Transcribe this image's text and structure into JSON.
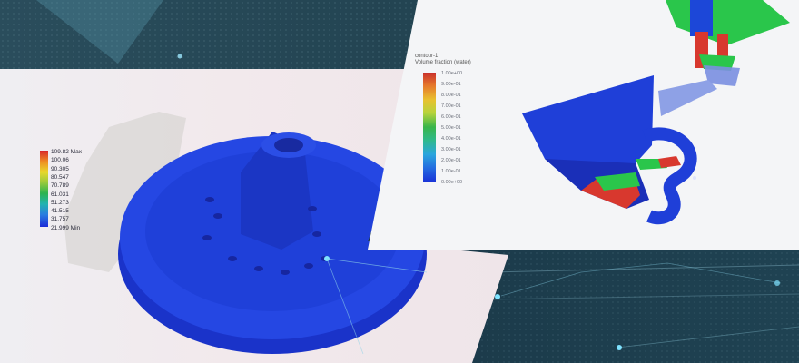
{
  "left_legend": {
    "labels": [
      "109.82 Max",
      "100.06",
      "90.305",
      "80.547",
      "70.789",
      "61.031",
      "51.273",
      "41.515",
      "31.757",
      "21.999 Min"
    ]
  },
  "right_legend": {
    "title_line1": "contour-1",
    "title_line2": "Volume fraction (water)",
    "labels": [
      "1.00e+00",
      "9.00e-01",
      "8.00e-01",
      "7.00e-01",
      "6.00e-01",
      "5.00e-01",
      "4.00e-01",
      "3.00e-01",
      "2.00e-01",
      "1.00e-01",
      "0.00e+00"
    ]
  },
  "icons": [
    "brake-disc-model-icon",
    "casting-mold-model-icon",
    "network-node-icon"
  ]
}
